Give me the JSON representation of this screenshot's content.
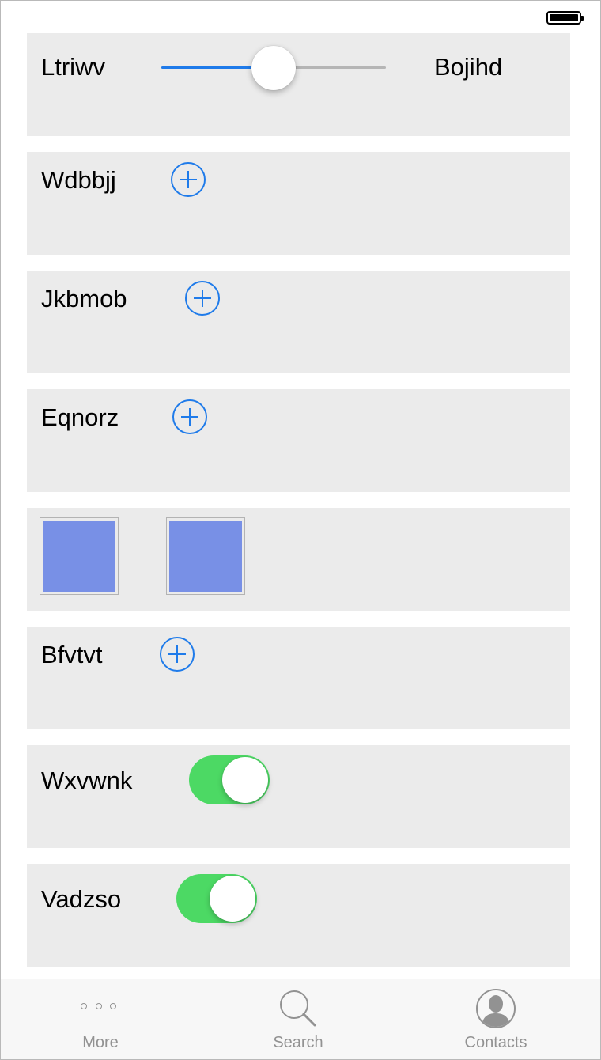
{
  "status_bar": {
    "battery_icon": "battery-full-icon"
  },
  "slider_row": {
    "left_label": "Ltriwv",
    "right_label": "Bojihd",
    "value_fraction": 0.5
  },
  "add_rows": [
    {
      "label": "Wdbbjj",
      "icon": "plus-circle-icon"
    },
    {
      "label": "Jkbmob",
      "icon": "plus-circle-icon"
    },
    {
      "label": "Eqnorz",
      "icon": "plus-circle-icon"
    }
  ],
  "image_row": {
    "images": [
      {
        "color": "#7890e6"
      },
      {
        "color": "#7890e6"
      }
    ]
  },
  "add_row_2": {
    "label": "Bfvtvt",
    "icon": "plus-circle-icon"
  },
  "toggle_rows": [
    {
      "label": "Wxvwnk",
      "on": true
    },
    {
      "label": "Vadzso",
      "on": true
    }
  ],
  "colors": {
    "accent": "#1f7bea",
    "toggle_on": "#4cd964",
    "card_bg": "#ebebeb"
  },
  "tabbar": {
    "tabs": [
      {
        "label": "More",
        "icon": "more-dots-icon"
      },
      {
        "label": "Search",
        "icon": "search-icon"
      },
      {
        "label": "Contacts",
        "icon": "contacts-icon"
      }
    ]
  }
}
